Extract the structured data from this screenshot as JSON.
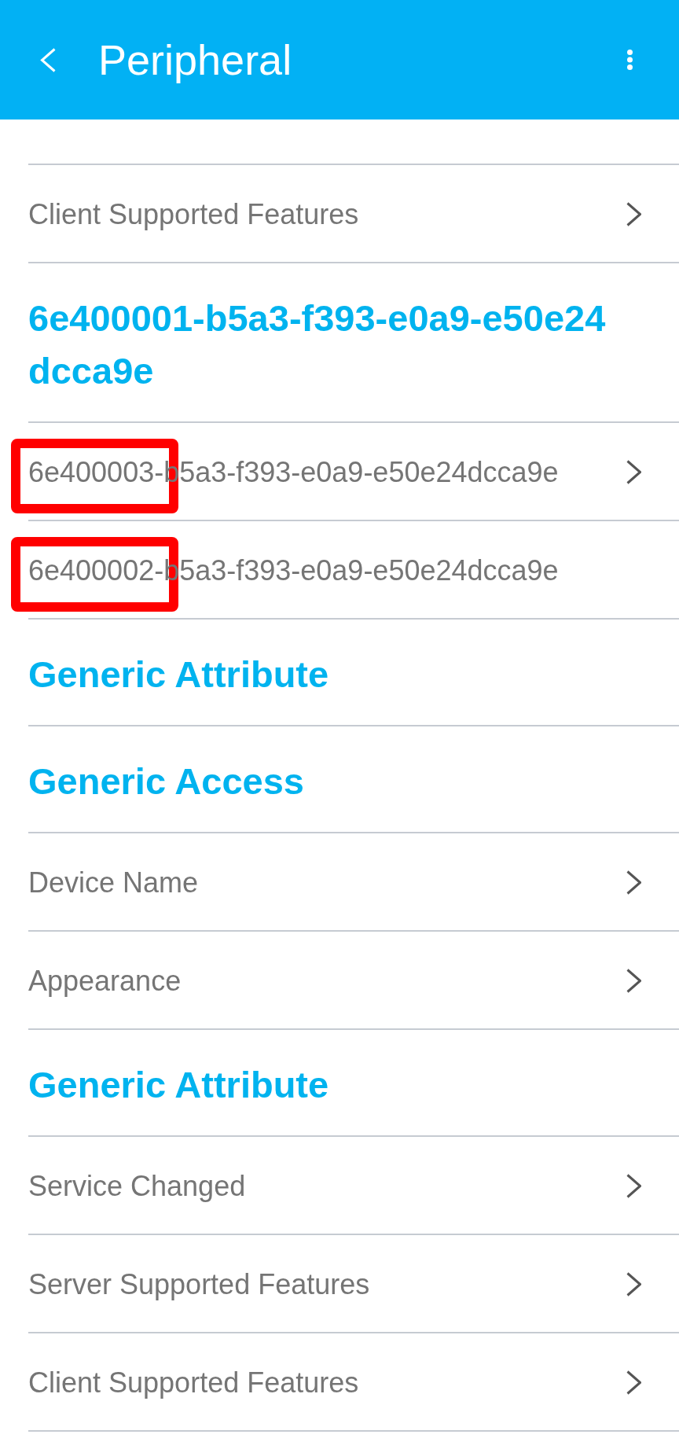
{
  "app_bar": {
    "title": "Peripheral"
  },
  "sections": [
    {
      "items": [
        {
          "label": "Client Supported Features",
          "openable": true,
          "highlighted": false
        }
      ]
    },
    {
      "title": "6e400001-b5a3-f393-e0a9-e50e24dcca9e",
      "items": [
        {
          "label": "6e400003-b5a3-f393-e0a9-e50e24dcca9e",
          "openable": true,
          "highlighted": true
        },
        {
          "label": "6e400002-b5a3-f393-e0a9-e50e24dcca9e",
          "openable": false,
          "highlighted": true
        }
      ]
    },
    {
      "title": "Generic Attribute"
    },
    {
      "title": "Generic Access",
      "items": [
        {
          "label": "Device Name",
          "openable": true,
          "highlighted": false
        },
        {
          "label": "Appearance",
          "openable": true,
          "highlighted": false
        }
      ]
    },
    {
      "title": "Generic Attribute",
      "items": [
        {
          "label": "Service Changed",
          "openable": true,
          "highlighted": false
        },
        {
          "label": "Server Supported Features",
          "openable": true,
          "highlighted": false
        },
        {
          "label": "Client Supported Features",
          "openable": true,
          "highlighted": false
        }
      ]
    }
  ]
}
